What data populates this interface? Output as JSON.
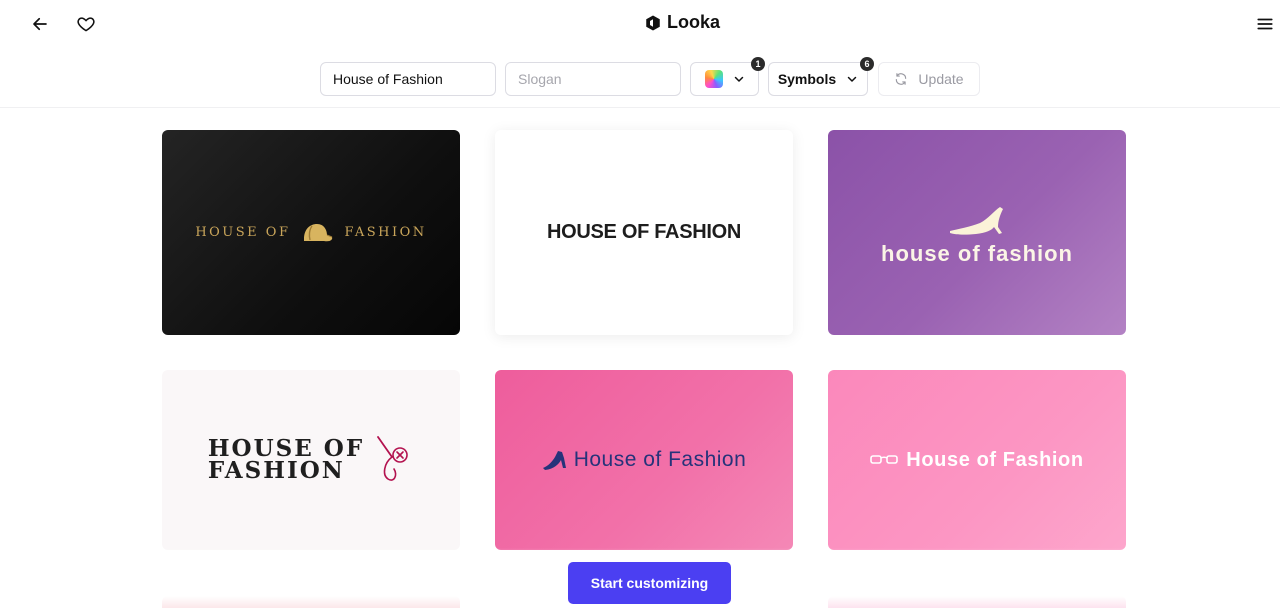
{
  "app": {
    "name": "Looka"
  },
  "toolbar": {
    "name_value": "House of Fashion",
    "slogan_placeholder": "Slogan",
    "colors_badge": "1",
    "symbols_label": "Symbols",
    "symbols_badge": "6",
    "update_label": "Update"
  },
  "logos": [
    {
      "left": "HOUSE OF",
      "right": "FASHION"
    },
    {
      "text": "HOUSE OF FASHION"
    },
    {
      "text": "house of fashion"
    },
    {
      "line1": "HOUSE OF",
      "line2": "FASHION"
    },
    {
      "text": "House of Fashion"
    },
    {
      "text": "House of Fashion"
    }
  ],
  "cta": {
    "label": "Start customizing"
  },
  "colors": {
    "accent": "#4b3ff2",
    "black_card": "#141414",
    "purple_card": "#9a5fb0",
    "pink_card": "#f06aa5",
    "light_pink_card": "#fb8fbf",
    "navy_text": "#26337a",
    "gold": "#c9a55a"
  },
  "icons": [
    "back-arrow-icon",
    "heart-icon",
    "menu-icon",
    "color-swatch-icon",
    "chevron-down-icon",
    "refresh-icon",
    "cap-icon",
    "high-heel-icon",
    "stiletto-icon",
    "glasses-icon",
    "needle-thread-icon"
  ]
}
